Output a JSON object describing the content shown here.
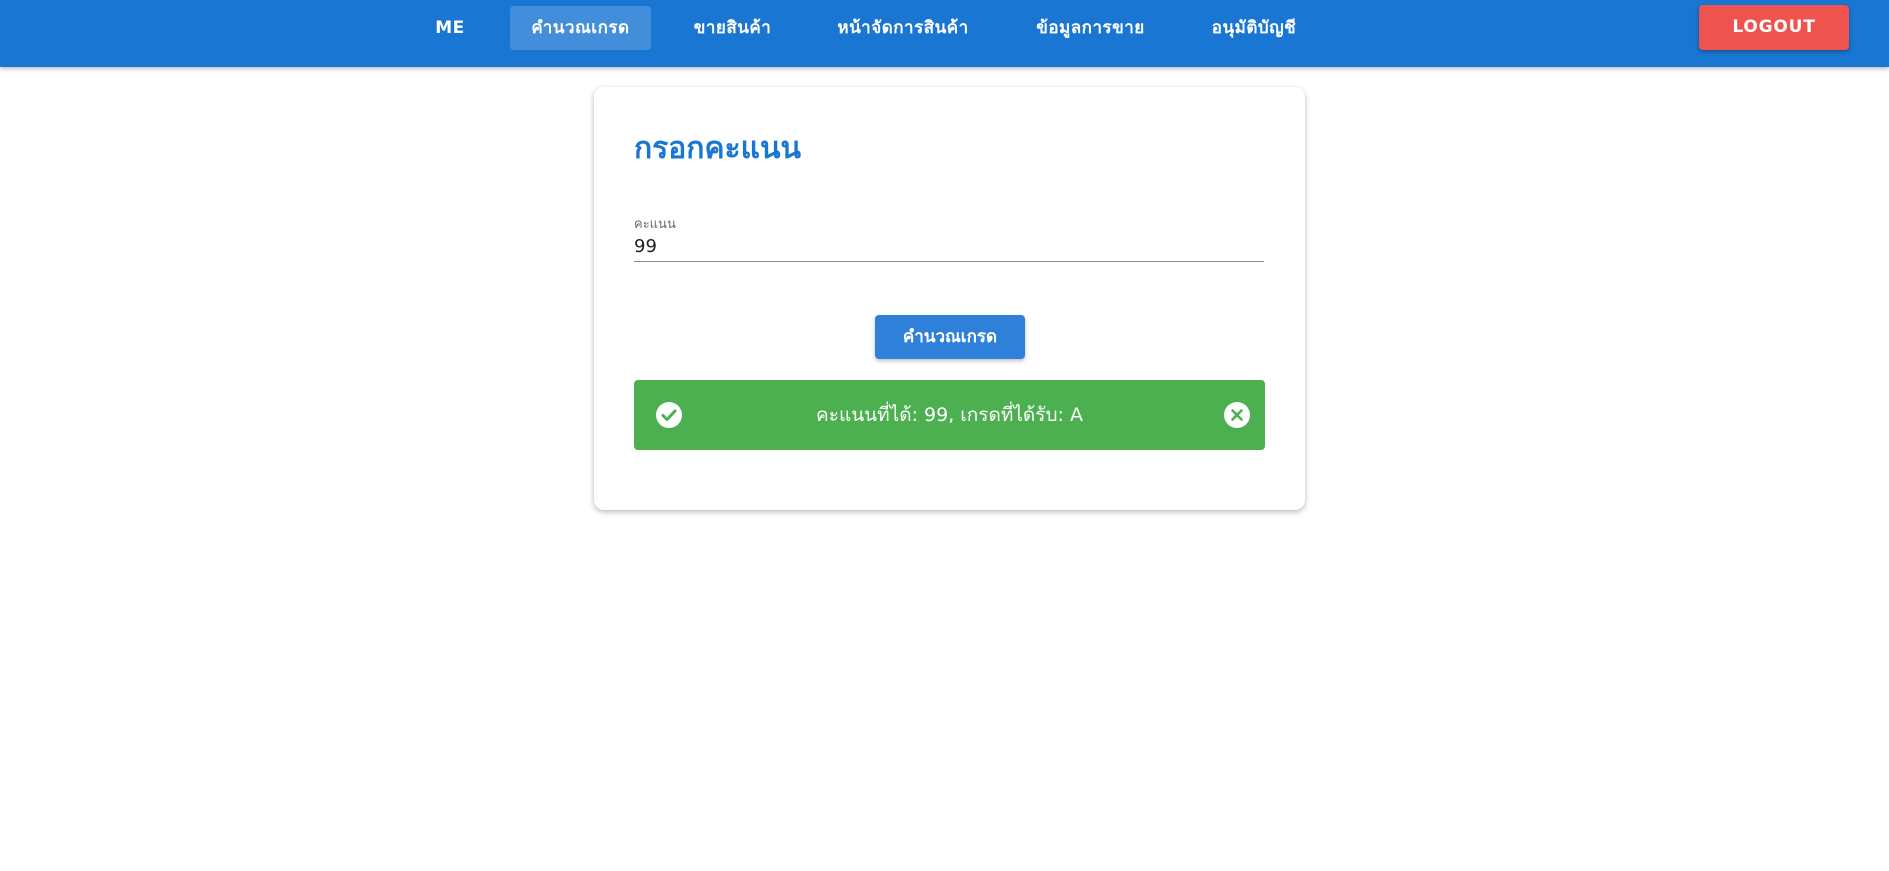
{
  "nav": {
    "items": [
      {
        "label": "ME",
        "active": false
      },
      {
        "label": "คำนวณเกรด",
        "active": true
      },
      {
        "label": "ขายสินค้า",
        "active": false
      },
      {
        "label": "หน้าจัดการสินค้า",
        "active": false
      },
      {
        "label": "ข้อมูลการขาย",
        "active": false
      },
      {
        "label": "อนุมัติบัญชี",
        "active": false
      }
    ],
    "logout_label": "LOGOUT"
  },
  "form": {
    "title": "กรอกคะแนน",
    "score_label": "คะแนน",
    "score_value": "99",
    "submit_label": "คำนวณเกรด"
  },
  "alert": {
    "message": "คะแนนที่ได้: 99, เกรดที่ได้รับ: A",
    "icon": "check-circle-icon",
    "close_icon": "close-circle-icon"
  },
  "colors": {
    "primary": "#1976d2",
    "logout": "#ef5350",
    "success": "#4caf50",
    "background": "#ffffff"
  }
}
